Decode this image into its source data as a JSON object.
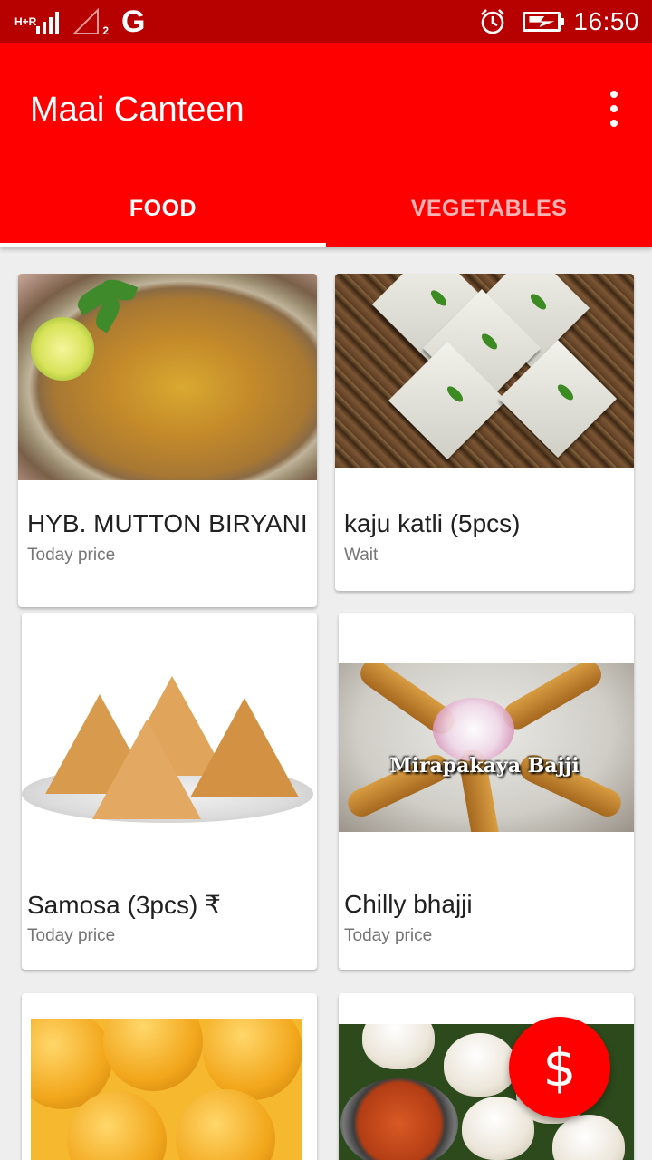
{
  "status_bar": {
    "network_label": "H+R",
    "sim2_label": "2",
    "g_icon": "G",
    "alarm_icon": "alarm-icon",
    "battery_icon": "battery-charging-icon",
    "time": "16:50"
  },
  "app_bar": {
    "title": "Maai Canteen",
    "overflow_icon": "more-vert-icon",
    "background_color": "#ff0000"
  },
  "tabs": [
    {
      "label": "FOOD",
      "active": true
    },
    {
      "label": "VEGETABLES",
      "active": false
    }
  ],
  "items": [
    {
      "name": "HYB. MUTTON BIRYANI",
      "price": "Today price",
      "image": "mutton biryani"
    },
    {
      "name": "kaju katli (5pcs)",
      "price": "Wait",
      "image": "kaju katli"
    },
    {
      "name": "Samosa (3pcs)   ₹",
      "price": "Today price",
      "image": "samosa"
    },
    {
      "name": "Chilly bhajji",
      "price": "Today price",
      "image": "mirapakaya bajji",
      "image_caption": "Mirapakaya Bajji"
    },
    {
      "name": "",
      "price": "",
      "image": "laddu"
    },
    {
      "name": "",
      "price": "",
      "image": "momos"
    }
  ],
  "fab": {
    "icon": "dollar-icon",
    "label": "$",
    "color": "#ff0000"
  }
}
